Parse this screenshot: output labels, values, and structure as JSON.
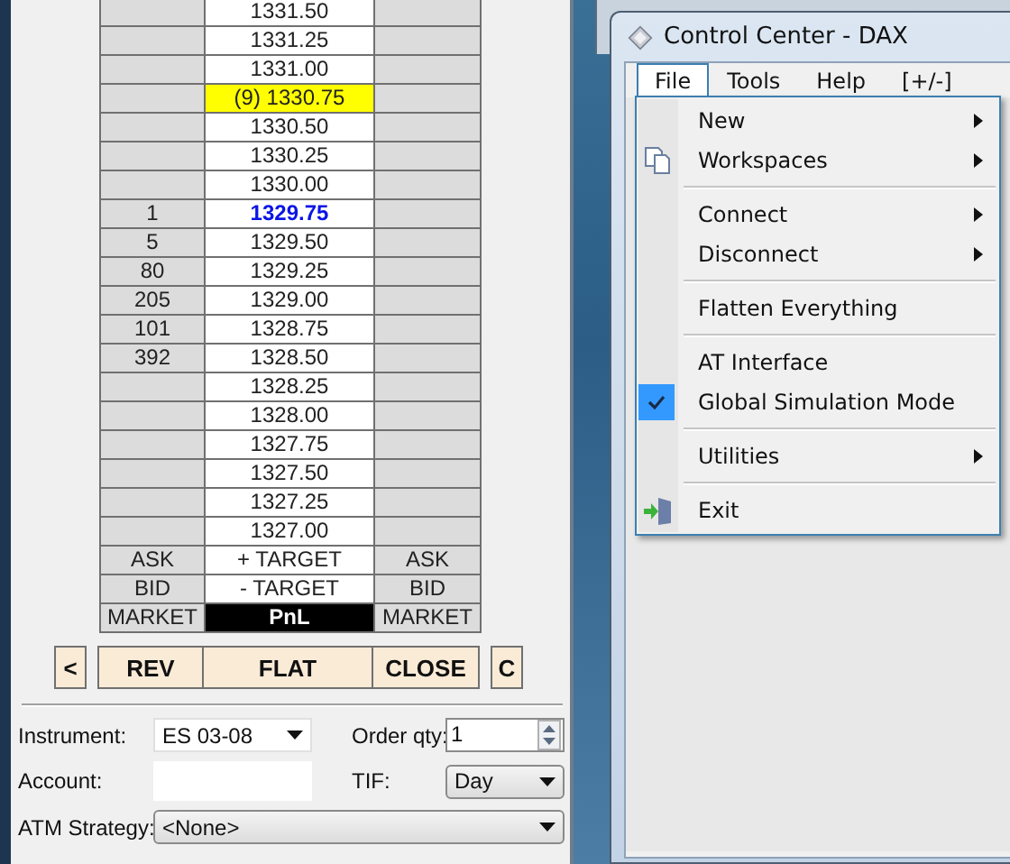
{
  "ladder": {
    "rows": [
      {
        "bid": "",
        "price": "1331.50",
        "ask": "",
        "kind": "normal"
      },
      {
        "bid": "",
        "price": "1331.25",
        "ask": "",
        "kind": "normal"
      },
      {
        "bid": "",
        "price": "1331.00",
        "ask": "",
        "kind": "normal"
      },
      {
        "bid": "",
        "price": "(9) 1330.75",
        "ask": "",
        "kind": "highlight"
      },
      {
        "bid": "",
        "price": "1330.50",
        "ask": "",
        "kind": "normal"
      },
      {
        "bid": "",
        "price": "1330.25",
        "ask": "",
        "kind": "normal"
      },
      {
        "bid": "",
        "price": "1330.00",
        "ask": "",
        "kind": "normal"
      },
      {
        "bid": "1",
        "price": "1329.75",
        "ask": "",
        "kind": "last"
      },
      {
        "bid": "5",
        "price": "1329.50",
        "ask": "",
        "kind": "normal"
      },
      {
        "bid": "80",
        "price": "1329.25",
        "ask": "",
        "kind": "normal"
      },
      {
        "bid": "205",
        "price": "1329.00",
        "ask": "",
        "kind": "normal"
      },
      {
        "bid": "101",
        "price": "1328.75",
        "ask": "",
        "kind": "normal"
      },
      {
        "bid": "392",
        "price": "1328.50",
        "ask": "",
        "kind": "normal"
      },
      {
        "bid": "",
        "price": "1328.25",
        "ask": "",
        "kind": "normal"
      },
      {
        "bid": "",
        "price": "1328.00",
        "ask": "",
        "kind": "normal"
      },
      {
        "bid": "",
        "price": "1327.75",
        "ask": "",
        "kind": "normal"
      },
      {
        "bid": "",
        "price": "1327.50",
        "ask": "",
        "kind": "normal"
      },
      {
        "bid": "",
        "price": "1327.25",
        "ask": "",
        "kind": "normal"
      },
      {
        "bid": "",
        "price": "1327.00",
        "ask": "",
        "kind": "normal"
      }
    ],
    "footer_rows": [
      {
        "left": "ASK",
        "center": "+ TARGET",
        "right": "ASK",
        "kind": "target"
      },
      {
        "left": "BID",
        "center": "- TARGET",
        "right": "BID",
        "kind": "target"
      },
      {
        "left": "MARKET",
        "center": "PnL",
        "right": "MARKET",
        "kind": "pnl"
      }
    ]
  },
  "buttons": [
    {
      "label": "<",
      "kind": "small"
    },
    {
      "label": "REV",
      "kind": "wide"
    },
    {
      "label": "FLAT",
      "kind": "center"
    },
    {
      "label": "CLOSE",
      "kind": "wide"
    },
    {
      "label": "C",
      "kind": "small"
    }
  ],
  "order_form": {
    "instrument": {
      "label": "Instrument:",
      "value": "ES 03-08"
    },
    "order_qty": {
      "label": "Order qty:",
      "value": "1"
    },
    "account": {
      "label": "Account:"
    },
    "tif": {
      "label": "TIF:",
      "value": "Day"
    },
    "atm_strategy": {
      "label": "ATM Strategy:",
      "value": "<None>"
    }
  },
  "window": {
    "title": "Control Center - DAX",
    "menu_bar": [
      {
        "label": "File",
        "selected": true
      },
      {
        "label": "Tools",
        "selected": false
      },
      {
        "label": "Help",
        "selected": false
      },
      {
        "label": "[+/-]",
        "selected": false
      }
    ],
    "file_menu": [
      [
        {
          "label": "New",
          "submenu": true,
          "checked": false
        },
        {
          "label": "Workspaces",
          "submenu": true,
          "checked": false,
          "kind": "pages"
        }
      ],
      [
        {
          "label": "Connect",
          "submenu": true,
          "checked": false
        },
        {
          "label": "Disconnect",
          "submenu": true,
          "checked": false
        }
      ],
      [
        {
          "label": "Flatten Everything",
          "submenu": false,
          "checked": false
        }
      ],
      [
        {
          "label": "AT Interface",
          "submenu": false,
          "checked": false
        },
        {
          "label": "Global Simulation Mode",
          "submenu": false,
          "checked": true
        }
      ],
      [
        {
          "label": "Utilities",
          "submenu": true,
          "checked": false
        }
      ],
      [
        {
          "label": "Exit",
          "submenu": false,
          "checked": false,
          "kind": "exit"
        }
      ]
    ]
  }
}
